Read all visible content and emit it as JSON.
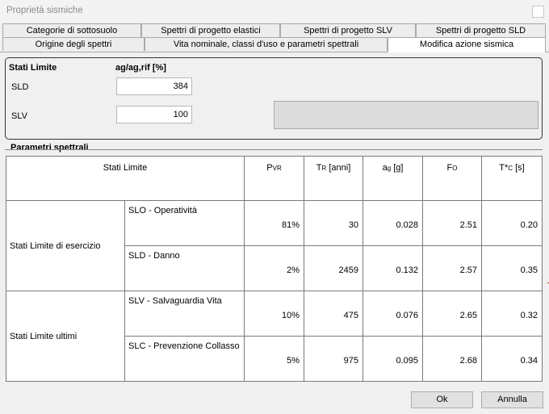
{
  "window": {
    "title": "Proprietà sismiche"
  },
  "tabs": {
    "row1": [
      "Categorie di sottosuolo",
      "Spettri di progetto elastici",
      "Spettri di progetto SLV",
      "Spettri di progetto SLD"
    ],
    "row2": [
      "Origine degli spettri",
      "Vita nominale, classi d'uso e parametri spettrali",
      "Modifica azione sismica"
    ],
    "active": "Modifica azione sismica"
  },
  "limit_states": {
    "header": "Stati Limite",
    "ratio_header_main": "ag/ag,rif",
    "ratio_header_unit": "[%]",
    "sld_label": "SLD",
    "sld_value": "384",
    "slv_label": "SLV",
    "slv_value": "100"
  },
  "spectral": {
    "title": "Parametri spettrali",
    "columns": {
      "stati_limite": "Stati Limite",
      "pvr_main": "P",
      "pvr_sub": "VR",
      "tr_main": "T",
      "tr_sub": "R",
      "tr_unit": " [anni]",
      "ag_main": "a",
      "ag_sub": "g",
      "ag_unit": " [g]",
      "fo_main": "F",
      "fo_sub": "O",
      "tc_main": "T*",
      "tc_sub": "C",
      "tc_unit": " [s]"
    },
    "groups": [
      "Stati Limite di esercizio",
      "Stati Limite ultimi"
    ],
    "rows": [
      {
        "name": "SLO - Operatività",
        "pvr": "81%",
        "tr": "30",
        "ag": "0.028",
        "fo": "2.51",
        "tc": "0.20"
      },
      {
        "name": "SLD - Danno",
        "pvr": "2%",
        "tr": "2459",
        "ag": "0.132",
        "fo": "2.57",
        "tc": "0.35"
      },
      {
        "name": "SLV - Salvaguardia Vita",
        "pvr": "10%",
        "tr": "475",
        "ag": "0.076",
        "fo": "2.65",
        "tc": "0.32"
      },
      {
        "name": "SLC - Prevenzione Collasso",
        "pvr": "5%",
        "tr": "975",
        "ag": "0.095",
        "fo": "2.68",
        "tc": "0.34"
      }
    ]
  },
  "buttons": {
    "ok": "Ok",
    "cancel": "Annulla"
  }
}
